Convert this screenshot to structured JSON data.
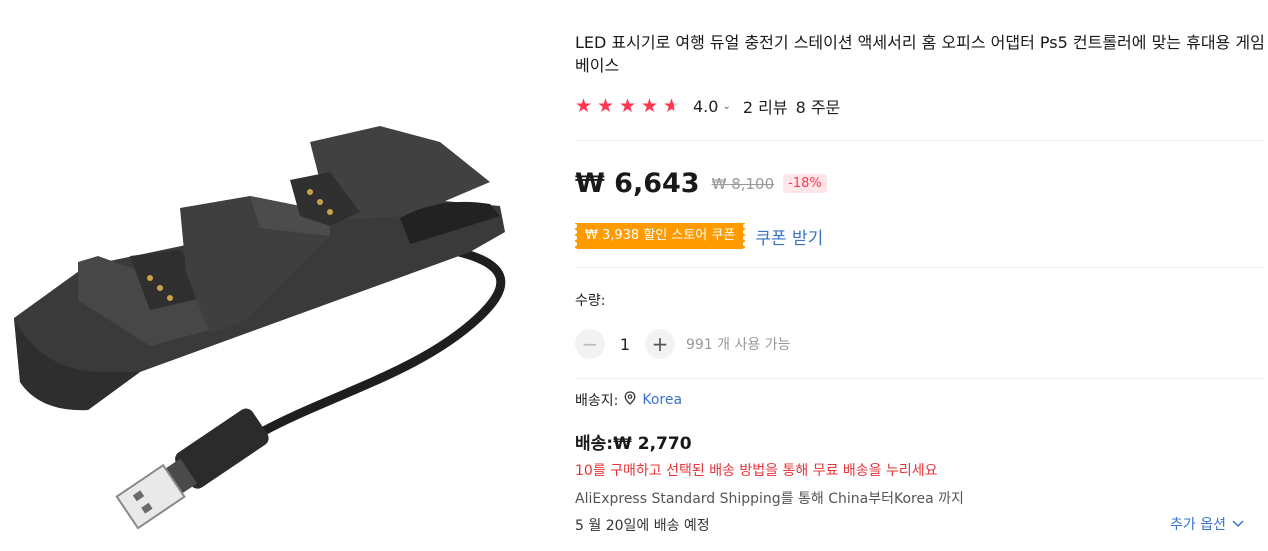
{
  "product": {
    "title": "LED 표시기로 여행 듀얼 충전기 스테이션 액세서리 홈 오피스 어댑터 Ps5 컨트롤러에 맞는 휴대용 게임베이스",
    "rating_value": "4.0",
    "rating_chevron": "⌄",
    "reviews": "2 리뷰",
    "orders": "8 주문",
    "stars": [
      "full",
      "full",
      "full",
      "full",
      "half"
    ]
  },
  "price": {
    "current": "₩ 6,643",
    "original": "₩ 8,100",
    "discount": "-18%"
  },
  "coupon": {
    "label": "₩ 3,938 할인 스토어 쿠폰",
    "get_label": "쿠폰 받기",
    "color": "#ff9a00"
  },
  "quantity": {
    "label": "수량:",
    "minus": "−",
    "value": "1",
    "plus": "+",
    "available": "991 개 사용 가능"
  },
  "shipping": {
    "to_label": "배송지:",
    "country": "Korea",
    "price_label": "배송:₩ 2,770",
    "free_notice": "10를 구매하고 선택된 배송 방법을 통해 무료 배송을 누리세요",
    "method": "AliExpress Standard Shipping를 통해 China부터Korea 까지",
    "delivery": "5 월 20일에 배송 예정",
    "more_options": "추가 옵션"
  },
  "colors": {
    "accent": "#fd384f",
    "link": "#3a73c9",
    "coupon": "#ff9a00"
  }
}
